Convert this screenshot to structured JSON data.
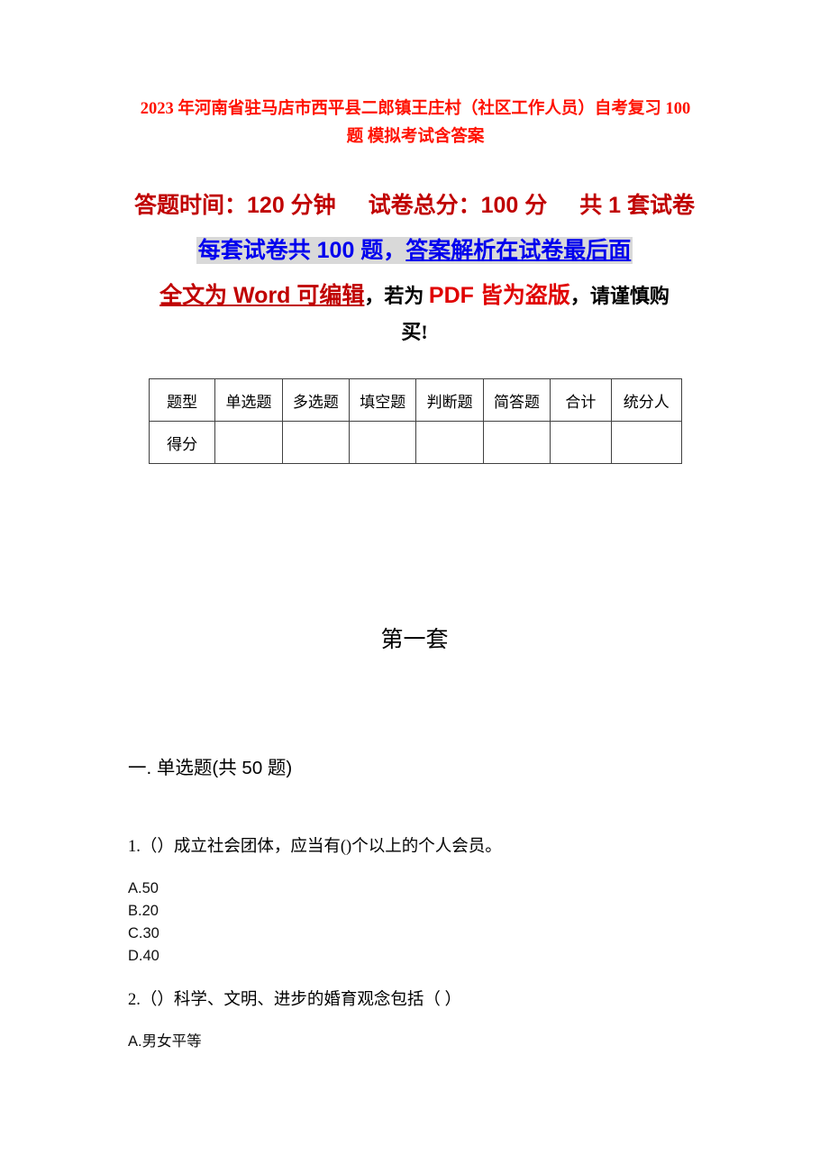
{
  "document": {
    "title": "2023 年河南省驻马店市西平县二郎镇王庄村（社区工作人员）自考复习 100 题模拟考试含答案",
    "title_line1": "2023 年河南省驻马店市西平县二郎镇王庄村（社区工作人员）自考复习 100 题",
    "title_line2": "模拟考试含答案",
    "title_color": "#FF1100"
  },
  "exam_info": {
    "duration_label": "答题时间：120 分钟",
    "total_score_label": "试卷总分：100 分",
    "set_count_label": "共 1 套试卷",
    "per_set_note_a": "每套试卷共 100 题，",
    "per_set_note_b": "答案解析在试卷最后面",
    "highlight_bg": "#D9D9D9",
    "highlight_color": "#0000EE",
    "notice_word": "全文为 Word 可编辑",
    "notice_sep1": "，若为 ",
    "notice_pdf": "PDF 皆为盗版",
    "notice_tail": "，请谨慎购",
    "notice_tail2": "买!",
    "notice_darkred": "#C00000",
    "notice_red": "#E00000"
  },
  "score_table": {
    "headers": [
      "题型",
      "单选题",
      "多选题",
      "填空题",
      "判断题",
      "简答题",
      "合计",
      "统分人"
    ],
    "rows": [
      {
        "label": "得分",
        "cells": [
          "",
          "",
          "",
          "",
          "",
          "",
          ""
        ]
      }
    ]
  },
  "set_heading": "第一套",
  "sections": [
    {
      "heading": "一. 单选题(共 50 题)",
      "questions": [
        {
          "stem": "1.（）成立社会团体，应当有()个以上的个人会员。",
          "options": [
            "A.50",
            "B.20",
            "C.30",
            "D.40"
          ]
        },
        {
          "stem": "2.（）科学、文明、进步的婚育观念包括（ ）",
          "options": [
            "A.男女平等"
          ]
        }
      ]
    }
  ]
}
